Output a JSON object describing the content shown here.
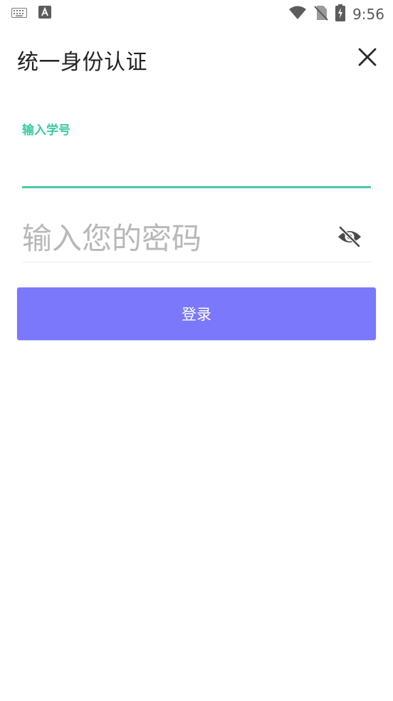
{
  "status_bar": {
    "time": "9:56",
    "icons": [
      "keyboard-icon",
      "font-a-icon",
      "wifi-icon",
      "no-sim-icon",
      "battery-charging-icon"
    ]
  },
  "header": {
    "title": "统一身份认证",
    "close_icon": "close-icon"
  },
  "form": {
    "student_id": {
      "label": "输入学号",
      "value": ""
    },
    "password": {
      "placeholder": "输入您的密码",
      "value": "",
      "toggle_icon": "eye-off-icon"
    },
    "login_label": "登录"
  },
  "colors": {
    "accent_green": "#4ec9a4",
    "button_purple": "#7b78fb"
  }
}
